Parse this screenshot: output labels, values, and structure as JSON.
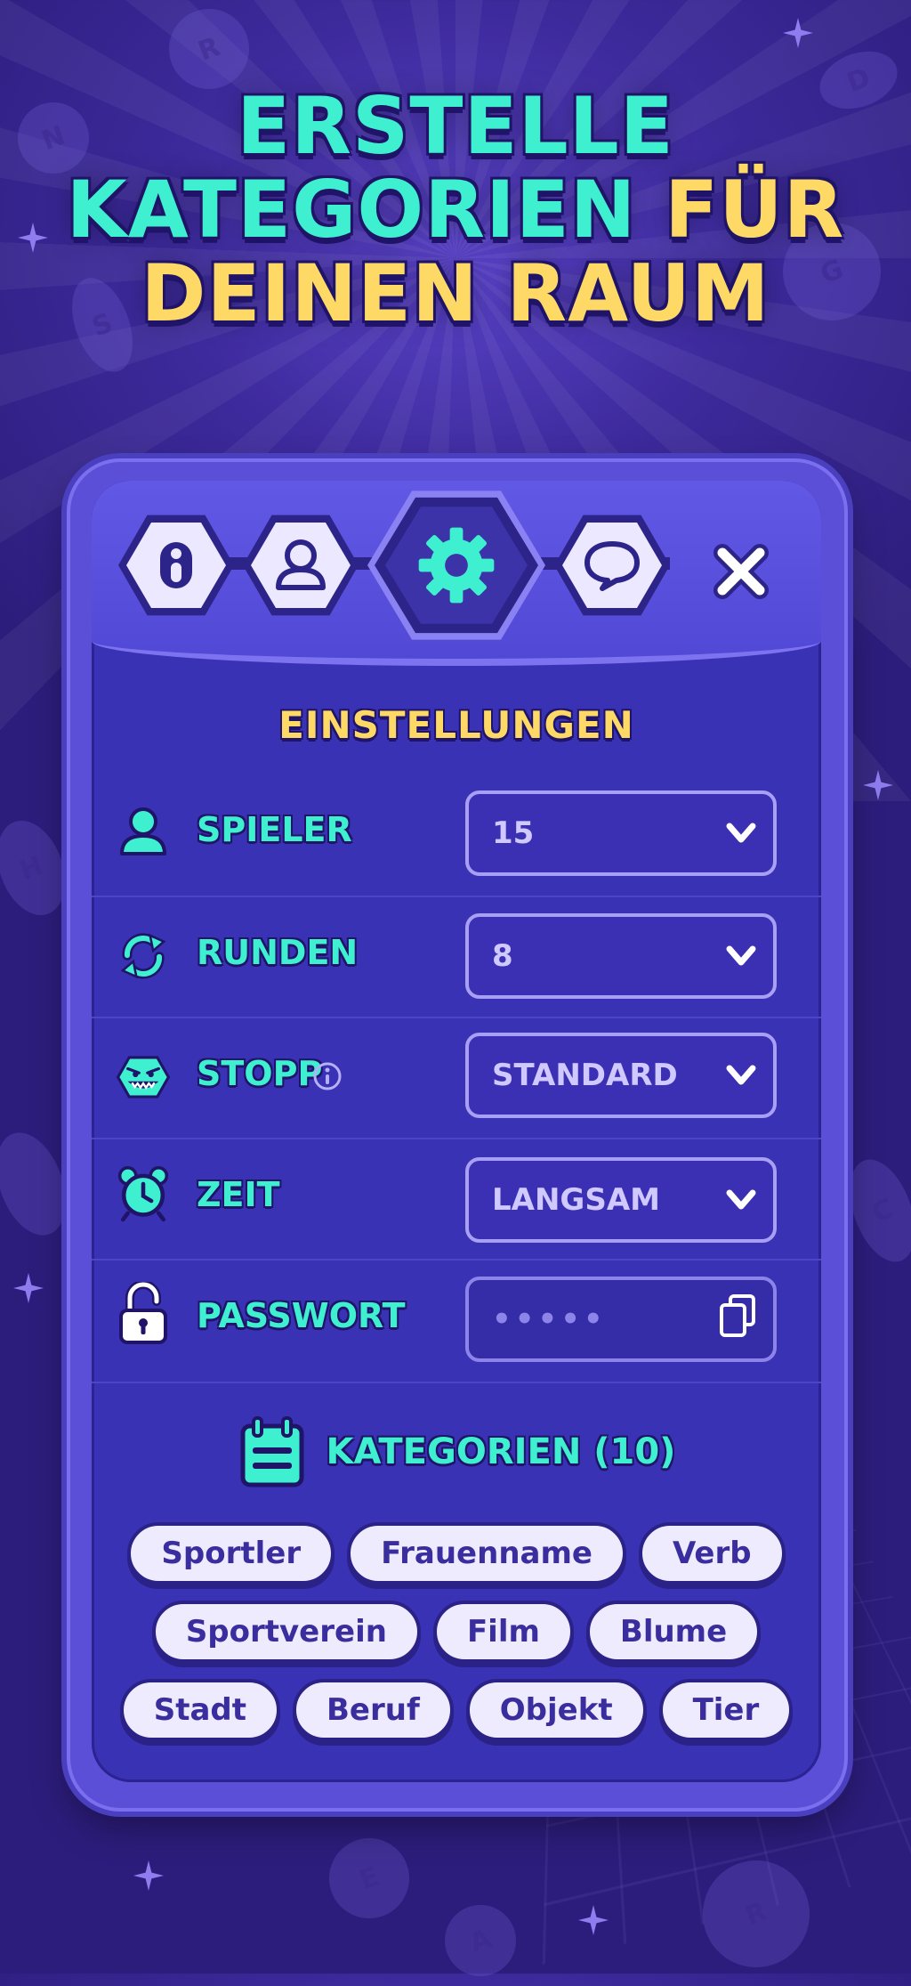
{
  "headline": {
    "line1": "ERSTELLE",
    "line2_a": "KATEGORIEN",
    "line2_b": "FÜR",
    "line3": "DEINEN RAUM"
  },
  "tabs": [
    {
      "icon": "info-icon"
    },
    {
      "icon": "user-icon"
    },
    {
      "icon": "gear-icon",
      "active": true
    },
    {
      "icon": "chat-icon"
    }
  ],
  "settings": {
    "title": "EINSTELLUNGEN",
    "rows": [
      {
        "icon": "player-icon",
        "label": "SPIELER",
        "value": "15"
      },
      {
        "icon": "rounds-icon",
        "label": "RUNDEN",
        "value": "8"
      },
      {
        "icon": "monster-icon",
        "label": "STOPP",
        "value": "STANDARD",
        "info_icon": "info-icon"
      },
      {
        "icon": "alarm-clock-icon",
        "label": "ZEIT",
        "value": "LANGSAM"
      },
      {
        "icon": "unlock-icon",
        "label": "PASSWORT",
        "value": "•••••",
        "action_icon": "copy-icon"
      }
    ]
  },
  "categories": {
    "title": "KATEGORIEN (10)",
    "icon": "calendar-list-icon",
    "chips": [
      [
        "Sportler",
        "Frauenname",
        "Verb"
      ],
      [
        "Sportverein",
        "Film",
        "Blume"
      ],
      [
        "Stadt",
        "Beruf",
        "Objekt",
        "Tier"
      ]
    ]
  },
  "colors": {
    "accent_teal": "#3ff0d0",
    "accent_yellow": "#ffd966",
    "panel": "#3a32b4",
    "background": "#3d2a9c"
  }
}
